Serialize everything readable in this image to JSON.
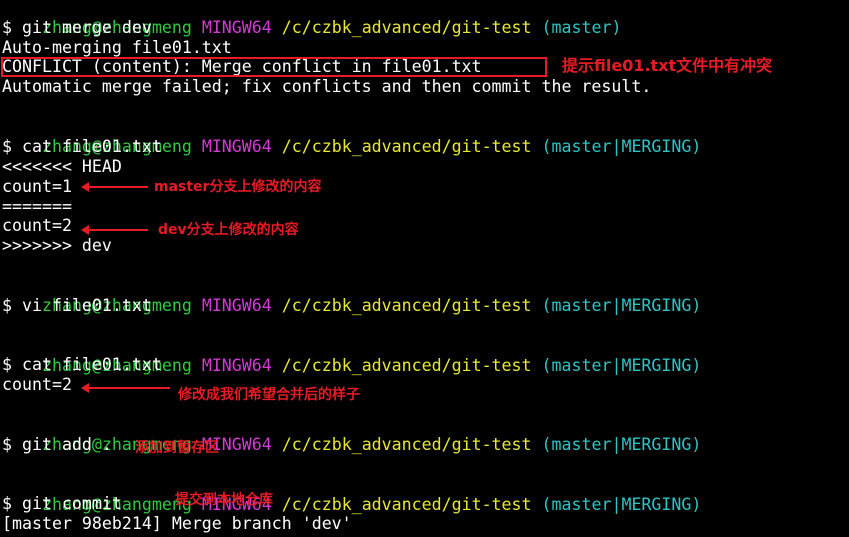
{
  "prompts": [
    {
      "user": "zhang@zhangmeng",
      "env": "MINGW64",
      "path": "/c/czbk_advanced/git-test",
      "branch": "(master)"
    },
    {
      "user": "zhang@zhangmeng",
      "env": "MINGW64",
      "path": "/c/czbk_advanced/git-test",
      "branch": "(master|MERGING)"
    },
    {
      "user": "zhang@zhangmeng",
      "env": "MINGW64",
      "path": "/c/czbk_advanced/git-test",
      "branch": "(master|MERGING)"
    },
    {
      "user": "zhang@zhangmeng",
      "env": "MINGW64",
      "path": "/c/czbk_advanced/git-test",
      "branch": "(master|MERGING)"
    },
    {
      "user": "zhang@zhangmeng",
      "env": "MINGW64",
      "path": "/c/czbk_advanced/git-test",
      "branch": "(master|MERGING)"
    },
    {
      "user": "zhang@zhangmeng",
      "env": "MINGW64",
      "path": "/c/czbk_advanced/git-test",
      "branch": "(master|MERGING)"
    }
  ],
  "output": {
    "cmd_merge": "$ git merge dev",
    "auto_merging": "Auto-merging file01.txt",
    "conflict": "CONFLICT (content): Merge conflict in file01.txt",
    "auto_failed": "Automatic merge failed; fix conflicts and then commit the result.",
    "cmd_cat1": "$ cat file01.txt",
    "head_marker": "<<<<<<< HEAD",
    "count1": "count=1",
    "separator": "=======",
    "count2": "count=2",
    "dev_marker": ">>>>>>> dev",
    "cmd_vi": "$ vi file01.txt",
    "cmd_cat2": "$ cat file01.txt",
    "count_final": "count=2",
    "cmd_add": "$ git add .",
    "cmd_commit": "$ git commit",
    "commit_result": "[master 98eb214] Merge branch 'dev'"
  },
  "annotations": {
    "conflict_note": "提示file01.txt文件中有冲突",
    "master_note": "master分支上修改的内容",
    "dev_note": "dev分支上修改的内容",
    "final_note": "修改成我们希望合并后的样子",
    "add_note": "添加到暂存区",
    "commit_note": "提交到本地仓库"
  },
  "colors": {
    "background": "#000000",
    "text": "#ffffff",
    "user": "#2ecc40",
    "env": "#d33ad6",
    "path": "#e8e832",
    "branch": "#2ec4c4",
    "annotation": "#e51c23"
  }
}
